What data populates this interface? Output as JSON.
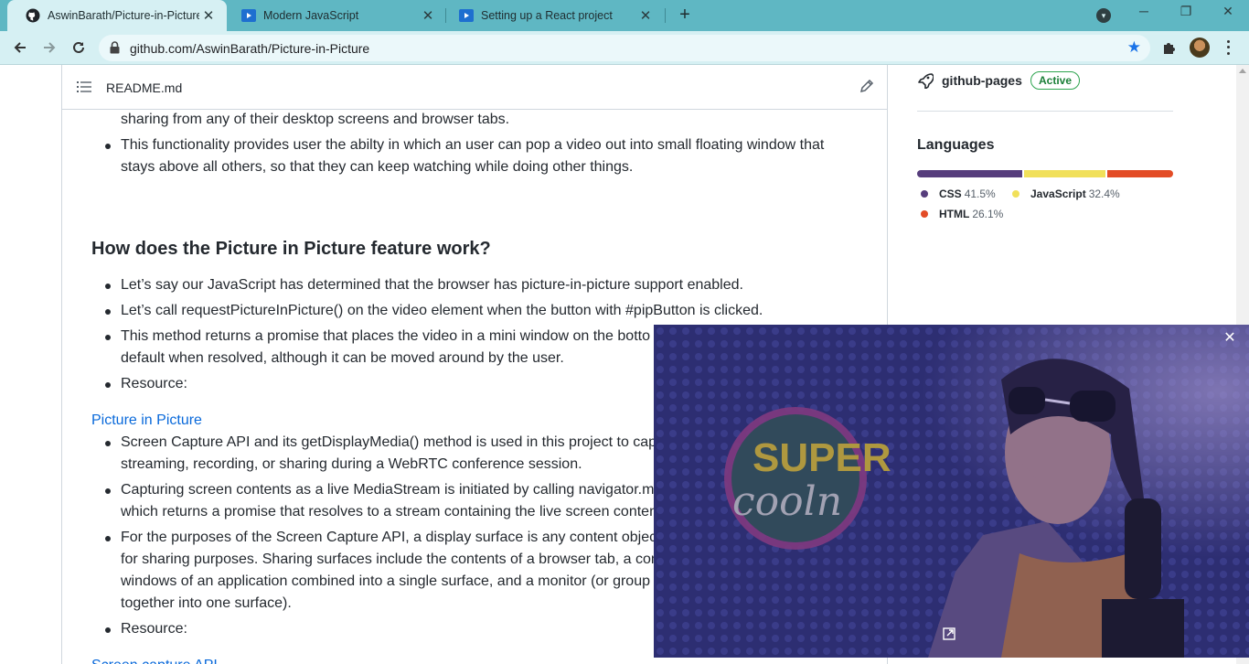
{
  "browser": {
    "tabs": [
      {
        "title": "AswinBarath/Picture-in-Picture",
        "icon": "github-icon",
        "active": true
      },
      {
        "title": "Modern JavaScript",
        "icon": "video-icon",
        "active": false
      },
      {
        "title": "Setting up a React project",
        "icon": "video-icon",
        "active": false
      }
    ],
    "new_tab_label": "+",
    "url": "github.com/AswinBarath/Picture-in-Picture"
  },
  "readme": {
    "filename": "README.md",
    "lines": {
      "l0": "sharing from any of their desktop screens and browser tabs.",
      "l1a": "This functionality provides user the abilty in which an user can pop a video out into small floating window that",
      "l1b": "stays above all others, so that they can keep watching while doing other things.",
      "h2": "How does the Picture in Picture feature work?",
      "b1": "Let’s say our JavaScript has determined that the browser has picture-in-picture support enabled.",
      "b2": "Let’s call requestPictureInPicture() on the video element when the button with #pipButton is clicked.",
      "b3a": "This method returns a promise that places the video in a mini window on the botto",
      "b3b": "default when resolved, although it can be moved around by the user.",
      "b4": "Resource:",
      "link1": "Picture in Picture",
      "c1a": "Screen Capture API and its getDisplayMedia() method is used in this project to capt",
      "c1b": "streaming, recording, or sharing during a WebRTC conference session.",
      "c2a": "Capturing screen contents as a live MediaStream is initiated by calling navigator.me",
      "c2b": "which returns a promise that resolves to a stream containing the live screen conten",
      "c3a": "For the purposes of the Screen Capture API, a display surface is any content object",
      "c3b": "for sharing purposes. Sharing surfaces include the contents of a browser tab, a com",
      "c3c": "windows of an application combined into a single surface, and a monitor (or group",
      "c3d": "together into one surface).",
      "c4": "Resource:",
      "link2": "Screen capture API"
    }
  },
  "sidebar": {
    "environment": {
      "name": "github-pages",
      "status": "Active"
    },
    "languages_title": "Languages",
    "languages": [
      {
        "name": "CSS",
        "percent": "41.5%",
        "value": 41.5,
        "color": "#563d7c"
      },
      {
        "name": "JavaScript",
        "percent": "32.4%",
        "value": 32.4,
        "color": "#f1e05a"
      },
      {
        "name": "HTML",
        "percent": "26.1%",
        "value": 26.1,
        "color": "#e34c26"
      }
    ]
  },
  "pip": {
    "logo_line1": "SUPER",
    "logo_line2": "cooln"
  }
}
